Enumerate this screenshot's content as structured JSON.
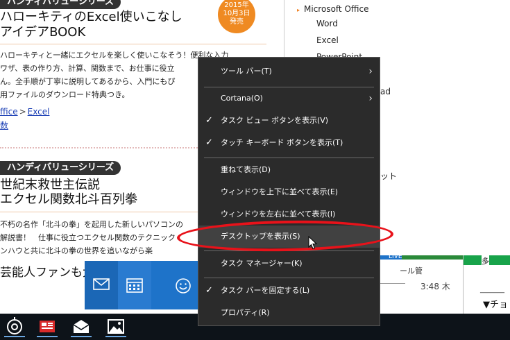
{
  "article1": {
    "series_badge": "ハンディバリューシリーズ",
    "title_line1": "ハローキティのExcel使いこなし",
    "title_line2": "アイデアBOOK",
    "date_badge": [
      "2015年",
      "10月3日",
      "発売"
    ],
    "desc_lines": [
      "ハローキティと一緒にエクセルを楽しく使いこなそう！便利な入力",
      "ワザ、表の作り方、計算、関数まで、お仕事に役立",
      "ん。全手順が丁寧に説明してあるから、入門にもぴ",
      "用ファイルのダウンロード特典つき。"
    ],
    "crumb_office": "ffice",
    "crumb_sep": ">",
    "crumb_excel": "Excel",
    "crumb_line2": "数"
  },
  "article2": {
    "series_badge": "ハンディバリューシリーズ",
    "title_line1": "世紀末救世主伝説",
    "title_line2": "エクセル関数北斗百列拳",
    "desc_lines": [
      "不朽の名作「北斗の拳」を起用した新しいパソコンの",
      "解説書！　仕事に役立つエクセル関数のテクニック",
      "ンハウと共に北斗の拳の世界を追いながら楽"
    ]
  },
  "sidebar": {
    "items": [
      {
        "label": "Microsoft Office",
        "arrow": "▸"
      },
      {
        "label": "Word"
      },
      {
        "label": "Excel"
      },
      {
        "label": "PowerPoint"
      },
      {
        "label": "ad"
      },
      {
        "label": "ット"
      }
    ]
  },
  "lower": {
    "left_text": "芸能人ファンも大",
    "notif_title": "ール管",
    "notif_time": "3:48 木",
    "live": "LIVE",
    "side_r1": "多",
    "side_r2": "_______",
    "side_r3": "▼チョ"
  },
  "menu": {
    "items": [
      {
        "label": "ツール バー(T)",
        "check": false,
        "submenu": true
      },
      {
        "label": "Cortana(O)",
        "check": false,
        "submenu": true
      },
      {
        "label": "タスク ビュー ボタンを表示(V)",
        "check": true,
        "submenu": false
      },
      {
        "label": "タッチ キーボード ボタンを表示(T)",
        "check": true,
        "submenu": false
      },
      {
        "label": "重ねて表示(D)",
        "check": false,
        "submenu": false
      },
      {
        "label": "ウィンドウを上下に並べて表示(E)",
        "check": false,
        "submenu": false
      },
      {
        "label": "ウィンドウを左右に並べて表示(I)",
        "check": false,
        "submenu": false
      },
      {
        "label": "デスクトップを表示(S)",
        "check": false,
        "submenu": false,
        "hover": true
      },
      {
        "label": "タスク マネージャー(K)",
        "check": false,
        "submenu": false
      },
      {
        "label": "タスク バーを固定する(L)",
        "check": true,
        "submenu": false
      },
      {
        "label": "プロパティ(R)",
        "check": false,
        "submenu": false
      }
    ],
    "check_glyph": "✓",
    "submenu_glyph": "›"
  },
  "colors": {
    "menu_bg": "#2b2b2b",
    "menu_hover": "#414141",
    "highlight_ellipse": "#e8121a",
    "date_badge": "#ef8a22",
    "mail_blue": "#1e73c9",
    "taskbar": "#0d1319"
  },
  "taskbar": {
    "icons": [
      "groove-music-icon",
      "news-app-icon",
      "mail-app-icon",
      "photos-app-icon"
    ]
  }
}
